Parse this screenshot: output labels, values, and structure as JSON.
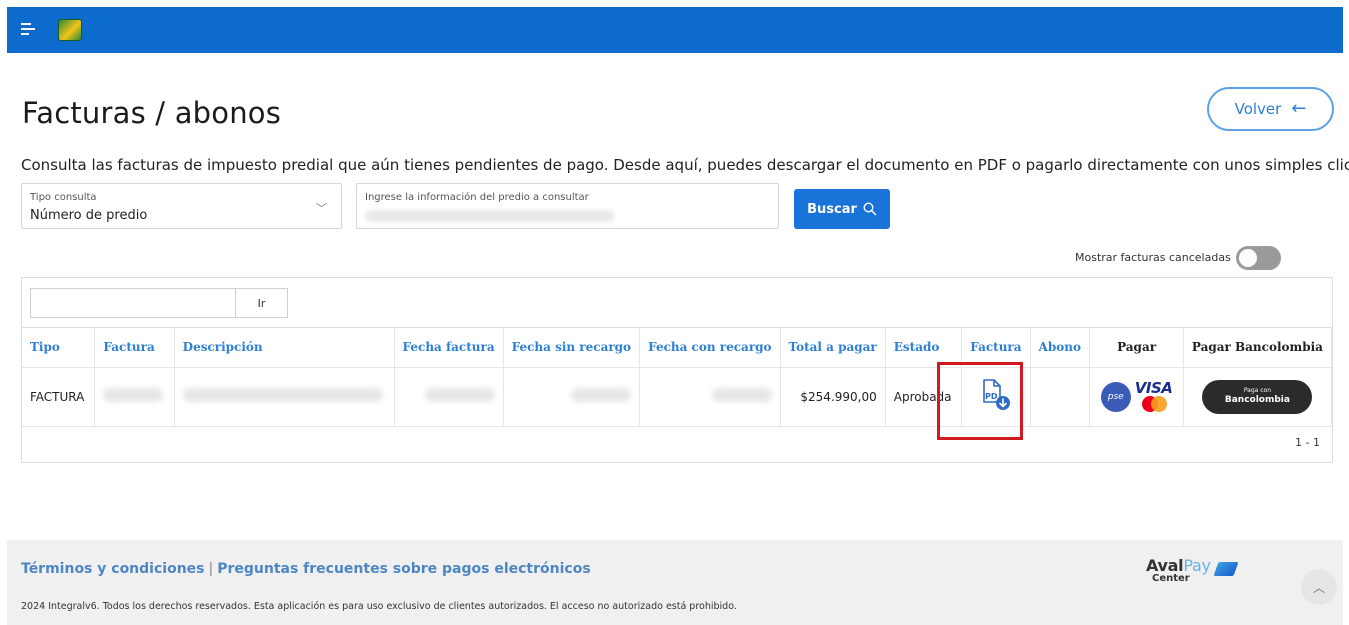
{
  "header": {
    "menu_icon": "hamburger-menu-icon",
    "logo_icon": "municipality-logo"
  },
  "page": {
    "title": "Facturas / abonos",
    "back_label": "Volver",
    "back_icon": "arrow-left-icon",
    "intro": "Consulta las facturas de impuesto predial que aún tienes pendientes de pago. Desde aquí, puedes descargar el documento en PDF o pagarlo directamente con unos simples clics."
  },
  "search": {
    "type_label": "Tipo consulta",
    "type_value": "Número de predio",
    "query_label": "Ingrese la información del predio a consultar",
    "button_label": "Buscar",
    "button_icon": "search-icon"
  },
  "toggle": {
    "label": "Mostrar facturas canceladas",
    "on": false
  },
  "table": {
    "filter_button": "Ir",
    "columns": [
      "Tipo",
      "Factura",
      "Descripción",
      "Fecha factura",
      "Fecha sin recargo",
      "Fecha con recargo",
      "Total a pagar",
      "Estado",
      "Factura",
      "Abono",
      "Pagar",
      "Pagar Bancolombia"
    ],
    "rows": [
      {
        "tipo": "FACTURA",
        "total": "$254.990,00",
        "estado": "Aprobada"
      }
    ],
    "pager": "1 - 1"
  },
  "payment": {
    "pse": "pse",
    "visa": "VISA",
    "banco_small": "Paga con",
    "banco_big": "Bancolombia"
  },
  "footer": {
    "terms": "Términos y condiciones",
    "separator": "|",
    "faq": "Preguntas frecuentes sobre pagos electrónicos",
    "legal": "2024 Integralv6. Todos los derechos reservados. Esta aplicación es para uso exclusivo de clientes autorizados. El acceso no autorizado está prohibido.",
    "brand_a": "Aval",
    "brand_b": "Pay",
    "brand_sub": "Center"
  },
  "colors": {
    "primary": "#0d6bce",
    "accent": "#2d7fd3",
    "highlight": "#d2191f",
    "footer_bg": "#f0f0f0"
  }
}
